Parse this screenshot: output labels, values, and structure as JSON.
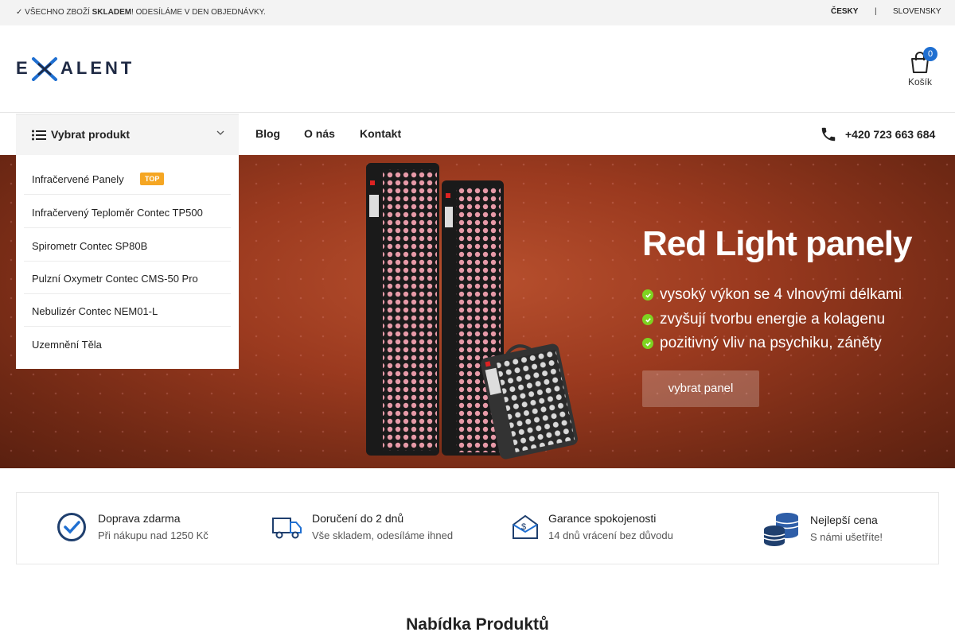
{
  "topbar": {
    "promo_check": "✓ VŠECHNO ZBOŽÍ ",
    "promo_bold": "SKLADEM",
    "promo_rest": "! ODESÍLÁME V DEN OBJEDNÁVKY.",
    "lang_cz": "ČESKY",
    "lang_sep": "|",
    "lang_sk": "SLOVENSKY"
  },
  "header": {
    "logo_text": "EXALENT",
    "cart_count": "0",
    "cart_label": "Košík"
  },
  "nav": {
    "category_button": "Vybrat produkt",
    "links": [
      "Blog",
      "O nás",
      "Kontakt"
    ],
    "phone": "+420 723 663 684"
  },
  "dropdown": {
    "items": [
      {
        "label": "Infračervené Panely",
        "badge": "TOP"
      },
      {
        "label": "Infračervený Teploměr Contec TP500"
      },
      {
        "label": "Spirometr Contec SP80B"
      },
      {
        "label": "Pulzní Oxymetr Contec CMS-50 Pro"
      },
      {
        "label": "Nebulizér Contec NEM01-L"
      },
      {
        "label": "Uzemnění Těla"
      }
    ]
  },
  "hero": {
    "title": "Red Light panely",
    "bullets": [
      "vysoký výkon se 4 vlnovými délkami",
      "zvyšují tvorbu energie a kolagenu",
      "pozitivný vliv na psychiku, záněty"
    ],
    "cta": "vybrat panel"
  },
  "features": [
    {
      "title": "Doprava zdarma",
      "subtitle": "Při nákupu nad 1250 Kč",
      "icon": "check-circle-icon"
    },
    {
      "title": "Doručení do 2 dnů",
      "subtitle": "Vše skladem, odesíláme ihned",
      "icon": "truck-icon"
    },
    {
      "title": "Garance spokojenosti",
      "subtitle": "14 dnů vrácení bez důvodu",
      "icon": "money-envelope-icon"
    },
    {
      "title": "Nejlepší cena",
      "subtitle": "S námi ušetříte!",
      "icon": "coins-icon"
    }
  ],
  "section": {
    "title": "Nabídka Produktů"
  },
  "colors": {
    "accent": "#1f6fd1",
    "badge": "#f5a623",
    "check": "#7ed321",
    "navy": "#1f2a44"
  }
}
